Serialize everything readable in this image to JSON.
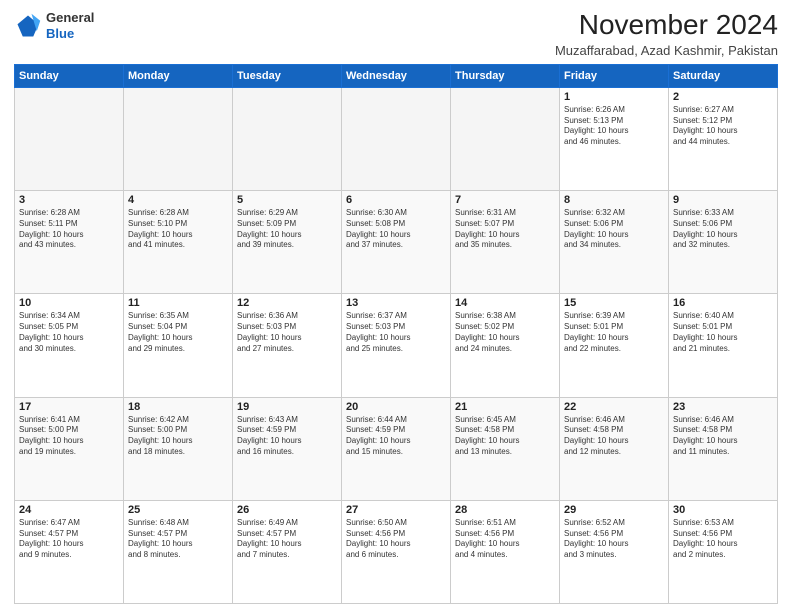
{
  "logo": {
    "line1": "General",
    "line2": "Blue"
  },
  "header": {
    "month": "November 2024",
    "location": "Muzaffarabad, Azad Kashmir, Pakistan"
  },
  "days_of_week": [
    "Sunday",
    "Monday",
    "Tuesday",
    "Wednesday",
    "Thursday",
    "Friday",
    "Saturday"
  ],
  "weeks": [
    [
      {
        "day": "",
        "info": ""
      },
      {
        "day": "",
        "info": ""
      },
      {
        "day": "",
        "info": ""
      },
      {
        "day": "",
        "info": ""
      },
      {
        "day": "",
        "info": ""
      },
      {
        "day": "1",
        "info": "Sunrise: 6:26 AM\nSunset: 5:13 PM\nDaylight: 10 hours\nand 46 minutes."
      },
      {
        "day": "2",
        "info": "Sunrise: 6:27 AM\nSunset: 5:12 PM\nDaylight: 10 hours\nand 44 minutes."
      }
    ],
    [
      {
        "day": "3",
        "info": "Sunrise: 6:28 AM\nSunset: 5:11 PM\nDaylight: 10 hours\nand 43 minutes."
      },
      {
        "day": "4",
        "info": "Sunrise: 6:28 AM\nSunset: 5:10 PM\nDaylight: 10 hours\nand 41 minutes."
      },
      {
        "day": "5",
        "info": "Sunrise: 6:29 AM\nSunset: 5:09 PM\nDaylight: 10 hours\nand 39 minutes."
      },
      {
        "day": "6",
        "info": "Sunrise: 6:30 AM\nSunset: 5:08 PM\nDaylight: 10 hours\nand 37 minutes."
      },
      {
        "day": "7",
        "info": "Sunrise: 6:31 AM\nSunset: 5:07 PM\nDaylight: 10 hours\nand 35 minutes."
      },
      {
        "day": "8",
        "info": "Sunrise: 6:32 AM\nSunset: 5:06 PM\nDaylight: 10 hours\nand 34 minutes."
      },
      {
        "day": "9",
        "info": "Sunrise: 6:33 AM\nSunset: 5:06 PM\nDaylight: 10 hours\nand 32 minutes."
      }
    ],
    [
      {
        "day": "10",
        "info": "Sunrise: 6:34 AM\nSunset: 5:05 PM\nDaylight: 10 hours\nand 30 minutes."
      },
      {
        "day": "11",
        "info": "Sunrise: 6:35 AM\nSunset: 5:04 PM\nDaylight: 10 hours\nand 29 minutes."
      },
      {
        "day": "12",
        "info": "Sunrise: 6:36 AM\nSunset: 5:03 PM\nDaylight: 10 hours\nand 27 minutes."
      },
      {
        "day": "13",
        "info": "Sunrise: 6:37 AM\nSunset: 5:03 PM\nDaylight: 10 hours\nand 25 minutes."
      },
      {
        "day": "14",
        "info": "Sunrise: 6:38 AM\nSunset: 5:02 PM\nDaylight: 10 hours\nand 24 minutes."
      },
      {
        "day": "15",
        "info": "Sunrise: 6:39 AM\nSunset: 5:01 PM\nDaylight: 10 hours\nand 22 minutes."
      },
      {
        "day": "16",
        "info": "Sunrise: 6:40 AM\nSunset: 5:01 PM\nDaylight: 10 hours\nand 21 minutes."
      }
    ],
    [
      {
        "day": "17",
        "info": "Sunrise: 6:41 AM\nSunset: 5:00 PM\nDaylight: 10 hours\nand 19 minutes."
      },
      {
        "day": "18",
        "info": "Sunrise: 6:42 AM\nSunset: 5:00 PM\nDaylight: 10 hours\nand 18 minutes."
      },
      {
        "day": "19",
        "info": "Sunrise: 6:43 AM\nSunset: 4:59 PM\nDaylight: 10 hours\nand 16 minutes."
      },
      {
        "day": "20",
        "info": "Sunrise: 6:44 AM\nSunset: 4:59 PM\nDaylight: 10 hours\nand 15 minutes."
      },
      {
        "day": "21",
        "info": "Sunrise: 6:45 AM\nSunset: 4:58 PM\nDaylight: 10 hours\nand 13 minutes."
      },
      {
        "day": "22",
        "info": "Sunrise: 6:46 AM\nSunset: 4:58 PM\nDaylight: 10 hours\nand 12 minutes."
      },
      {
        "day": "23",
        "info": "Sunrise: 6:46 AM\nSunset: 4:58 PM\nDaylight: 10 hours\nand 11 minutes."
      }
    ],
    [
      {
        "day": "24",
        "info": "Sunrise: 6:47 AM\nSunset: 4:57 PM\nDaylight: 10 hours\nand 9 minutes."
      },
      {
        "day": "25",
        "info": "Sunrise: 6:48 AM\nSunset: 4:57 PM\nDaylight: 10 hours\nand 8 minutes."
      },
      {
        "day": "26",
        "info": "Sunrise: 6:49 AM\nSunset: 4:57 PM\nDaylight: 10 hours\nand 7 minutes."
      },
      {
        "day": "27",
        "info": "Sunrise: 6:50 AM\nSunset: 4:56 PM\nDaylight: 10 hours\nand 6 minutes."
      },
      {
        "day": "28",
        "info": "Sunrise: 6:51 AM\nSunset: 4:56 PM\nDaylight: 10 hours\nand 4 minutes."
      },
      {
        "day": "29",
        "info": "Sunrise: 6:52 AM\nSunset: 4:56 PM\nDaylight: 10 hours\nand 3 minutes."
      },
      {
        "day": "30",
        "info": "Sunrise: 6:53 AM\nSunset: 4:56 PM\nDaylight: 10 hours\nand 2 minutes."
      }
    ]
  ]
}
